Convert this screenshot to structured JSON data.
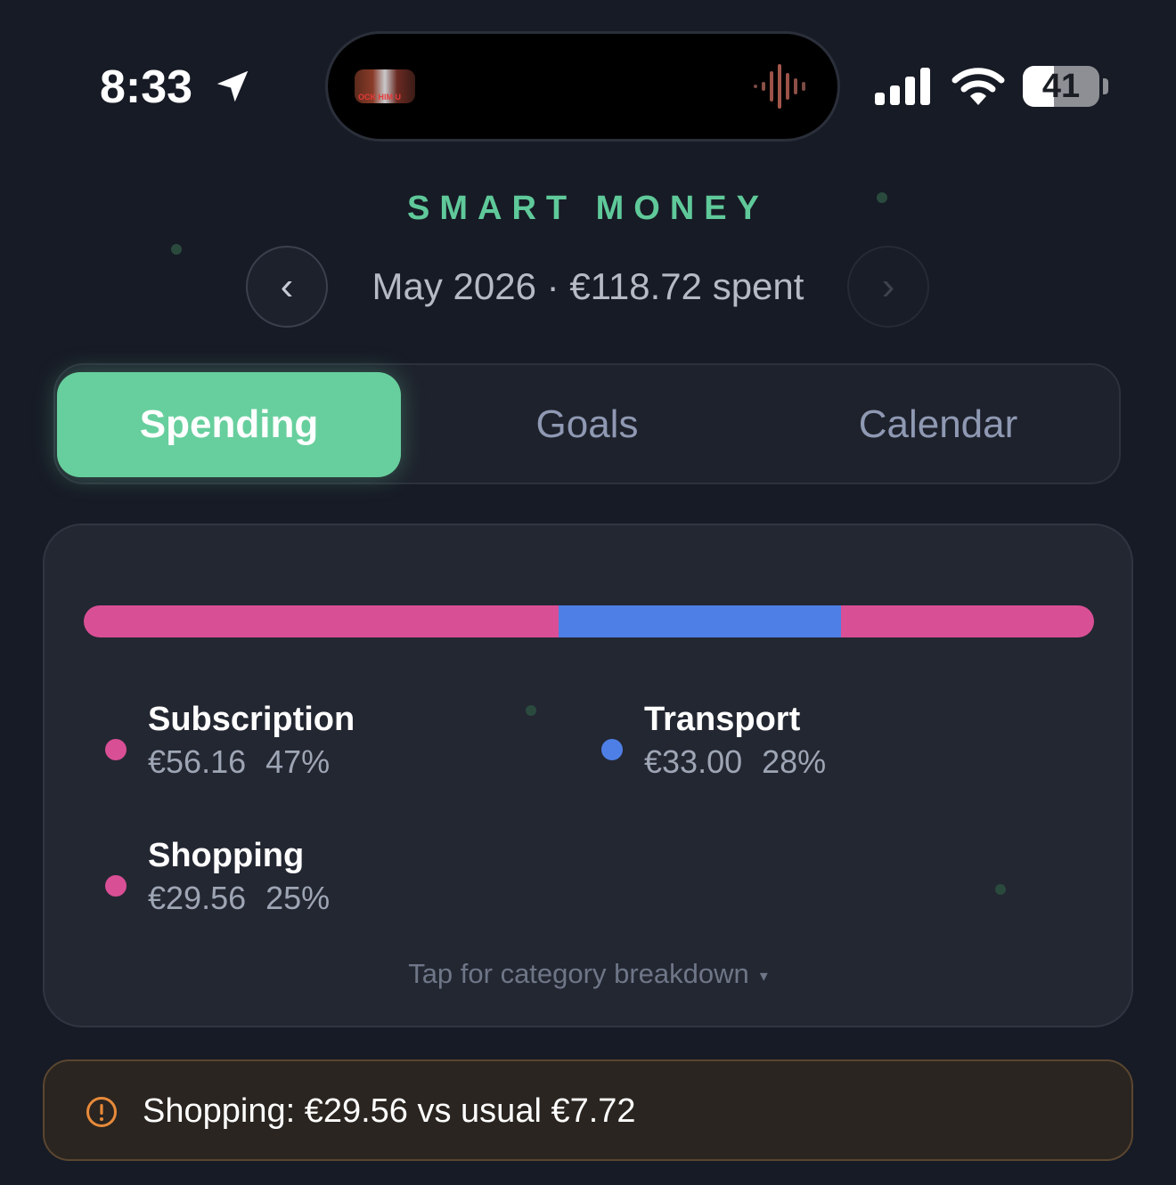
{
  "status_bar": {
    "time": "8:33",
    "battery_level": "41",
    "now_playing_art_text": "OCK HIM U"
  },
  "header": {
    "app_title": "SMART MONEY",
    "prev_label": "‹",
    "next_label": "›",
    "month_summary": "May 2026 · €118.72 spent"
  },
  "tabs": [
    {
      "label": "Spending",
      "active": true
    },
    {
      "label": "Goals",
      "active": false
    },
    {
      "label": "Calendar",
      "active": false
    }
  ],
  "spending_card": {
    "breakdown": [
      {
        "name": "Subscription",
        "amount": "€56.16",
        "percent": "47%",
        "share": 47,
        "color": "#d94f95"
      },
      {
        "name": "Transport",
        "amount": "€33.00",
        "percent": "28%",
        "share": 28,
        "color": "#4e7fe6"
      },
      {
        "name": "Shopping",
        "amount": "€29.56",
        "percent": "25%",
        "share": 25,
        "color": "#d94f95"
      }
    ],
    "hint": "Tap for category breakdown",
    "hint_caret": "▾"
  },
  "alert": {
    "icon": "warning-circle-icon",
    "text": "Shopping: €29.56 vs usual €7.72",
    "color": "#e88a3a"
  },
  "colors": {
    "accent": "#67cf9d",
    "background": "#171b25"
  }
}
